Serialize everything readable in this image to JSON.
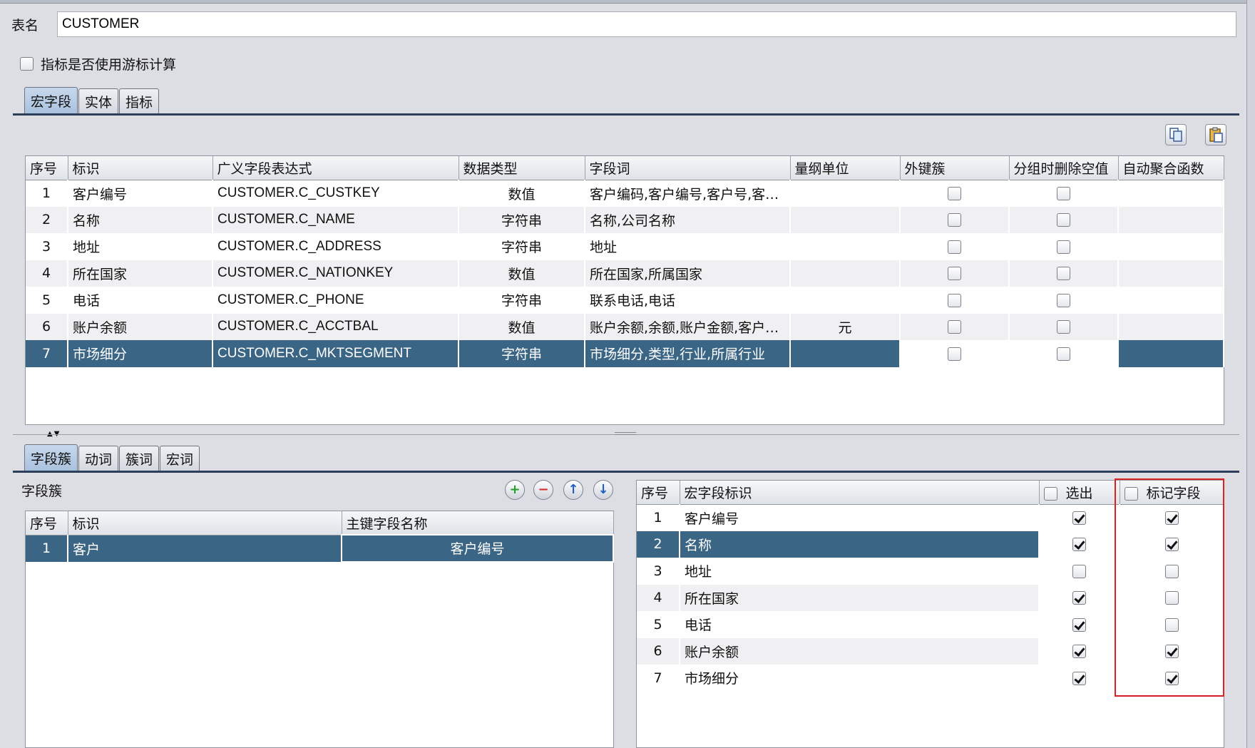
{
  "table_name": {
    "label": "表名",
    "value": "CUSTOMER"
  },
  "cursor_option": {
    "label": "指标是否使用游标计算",
    "checked": false
  },
  "top_tabs": [
    {
      "label": "宏字段",
      "active": true
    },
    {
      "label": "实体",
      "active": false
    },
    {
      "label": "指标",
      "active": false
    }
  ],
  "toolbar_icons": [
    "copy-icon",
    "paste-icon"
  ],
  "macro_table": {
    "headers": [
      "序号",
      "标识",
      "广义字段表达式",
      "数据类型",
      "字段词",
      "量纲单位",
      "外键簇",
      "分组时删除空值",
      "自动聚合函数"
    ],
    "rows": [
      {
        "no": "1",
        "id": "客户编号",
        "expr": "CUSTOMER.C_CUSTKEY",
        "type": "数值",
        "words": "客户编码,客户编号,客户号,客户ID",
        "unit": "",
        "fk": false,
        "drop_null": false,
        "agg": ""
      },
      {
        "no": "2",
        "id": "名称",
        "expr": "CUSTOMER.C_NAME",
        "type": "字符串",
        "words": "名称,公司名称",
        "unit": "",
        "fk": false,
        "drop_null": false,
        "agg": ""
      },
      {
        "no": "3",
        "id": "地址",
        "expr": "CUSTOMER.C_ADDRESS",
        "type": "字符串",
        "words": "地址",
        "unit": "",
        "fk": false,
        "drop_null": false,
        "agg": ""
      },
      {
        "no": "4",
        "id": "所在国家",
        "expr": "CUSTOMER.C_NATIONKEY",
        "type": "数值",
        "words": "所在国家,所属国家",
        "unit": "",
        "fk": false,
        "drop_null": false,
        "agg": ""
      },
      {
        "no": "5",
        "id": "电话",
        "expr": "CUSTOMER.C_PHONE",
        "type": "字符串",
        "words": "联系电话,电话",
        "unit": "",
        "fk": false,
        "drop_null": false,
        "agg": ""
      },
      {
        "no": "6",
        "id": "账户余额",
        "expr": "CUSTOMER.C_ACCTBAL",
        "type": "数值",
        "words": "账户余额,余额,账户金额,客户账...",
        "unit": "元",
        "fk": false,
        "drop_null": false,
        "agg": ""
      },
      {
        "no": "7",
        "id": "市场细分",
        "expr": "CUSTOMER.C_MKTSEGMENT",
        "type": "字符串",
        "words": "市场细分,类型,行业,所属行业",
        "unit": "",
        "fk": false,
        "drop_null": false,
        "agg": "",
        "selected": true
      }
    ]
  },
  "bottom_tabs": [
    {
      "label": "字段簇",
      "active": true
    },
    {
      "label": "动词",
      "active": false
    },
    {
      "label": "簇词",
      "active": false
    },
    {
      "label": "宏词",
      "active": false
    }
  ],
  "field_cluster": {
    "title": "字段簇",
    "buttons": [
      "add-icon",
      "remove-icon",
      "move-up-icon",
      "move-down-icon"
    ],
    "headers": [
      "序号",
      "标识",
      "主键字段名称"
    ],
    "rows": [
      {
        "no": "1",
        "id": "客户",
        "key_field": "客户编号",
        "selected": true
      }
    ]
  },
  "macro_select": {
    "headers": [
      "序号",
      "宏字段标识",
      "选出",
      "标记字段"
    ],
    "header_checks": {
      "select": false,
      "mark": false
    },
    "rows": [
      {
        "no": "1",
        "id": "客户编号",
        "select": true,
        "mark": true
      },
      {
        "no": "2",
        "id": "名称",
        "select": true,
        "mark": true,
        "selected": true
      },
      {
        "no": "3",
        "id": "地址",
        "select": false,
        "mark": false
      },
      {
        "no": "4",
        "id": "所在国家",
        "select": true,
        "mark": false
      },
      {
        "no": "5",
        "id": "电话",
        "select": true,
        "mark": false
      },
      {
        "no": "6",
        "id": "账户余额",
        "select": true,
        "mark": true
      },
      {
        "no": "7",
        "id": "市场细分",
        "select": true,
        "mark": true
      }
    ]
  },
  "colors": {
    "selection": "#3b6585",
    "highlight_box": "#e02020",
    "tab_line": "#2c3e5a"
  }
}
